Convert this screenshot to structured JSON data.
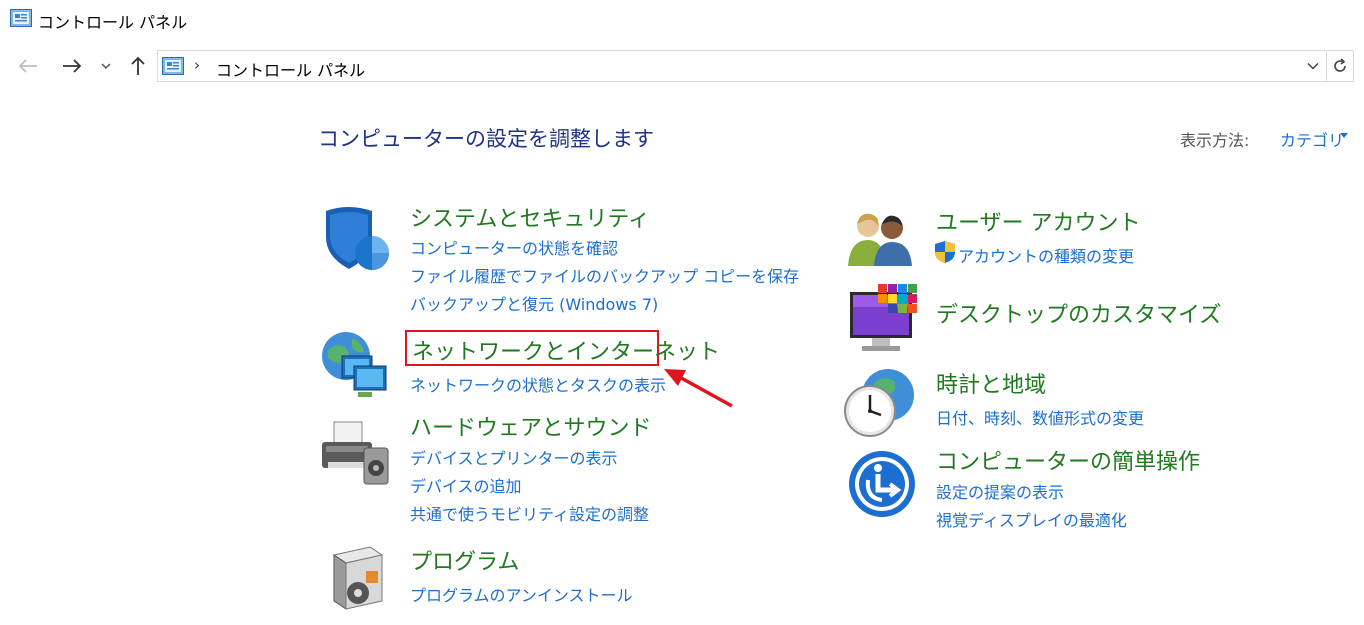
{
  "window": {
    "title": "コントロール パネル"
  },
  "address": {
    "path": "コントロール パネル"
  },
  "main": {
    "heading": "コンピューターの設定を調整します",
    "view_by_label": "表示方法:",
    "view_by_value": "カテゴリ"
  },
  "categories": [
    {
      "title": "システムとセキュリティ",
      "icon": "security-shield-icon",
      "links": [
        "コンピューターの状態を確認",
        "ファイル履歴でファイルのバックアップ コピーを保存",
        "バックアップと復元 (Windows 7)"
      ]
    },
    {
      "title": "ネットワークとインターネット",
      "icon": "network-globe-icon",
      "links": [
        "ネットワークの状態とタスクの表示"
      ]
    },
    {
      "title": "ハードウェアとサウンド",
      "icon": "printer-speaker-icon",
      "links": [
        "デバイスとプリンターの表示",
        "デバイスの追加",
        "共通で使うモビリティ設定の調整"
      ]
    },
    {
      "title": "プログラム",
      "icon": "programs-box-icon",
      "links": [
        "プログラムのアンインストール"
      ]
    },
    {
      "title": "ユーザー アカウント",
      "icon": "users-icon",
      "links": [
        "アカウントの種類の変更"
      ]
    },
    {
      "title": "デスクトップのカスタマイズ",
      "icon": "desktop-monitor-icon",
      "links": []
    },
    {
      "title": "時計と地域",
      "icon": "clock-globe-icon",
      "links": [
        "日付、時刻、数値形式の変更"
      ]
    },
    {
      "title": "コンピューターの簡単操作",
      "icon": "ease-of-access-icon",
      "links": [
        "設定の提案の表示",
        "視覚ディスプレイの最適化"
      ]
    }
  ],
  "colors": {
    "category": "#1f7a1f",
    "link": "#1c6fd0",
    "heading": "#1e3287",
    "highlight": "#e0141e"
  }
}
